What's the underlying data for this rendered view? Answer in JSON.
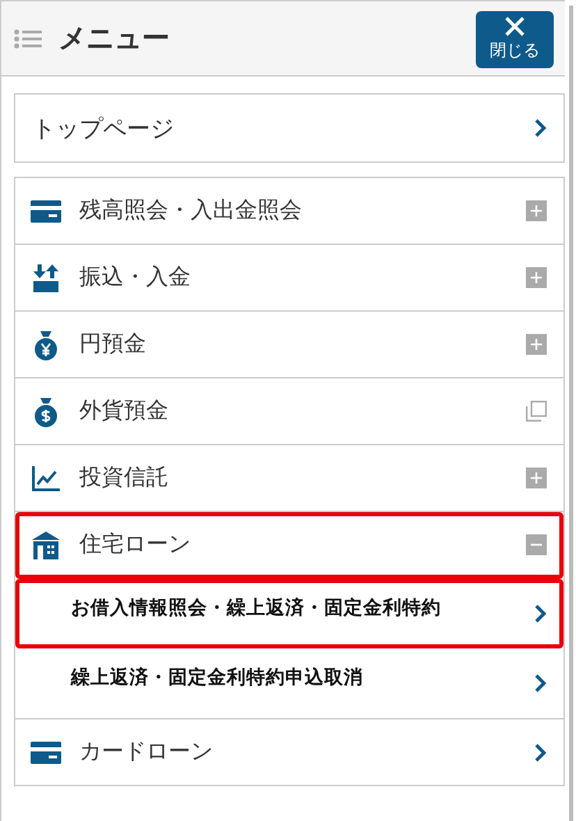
{
  "header": {
    "title": "メニュー",
    "close_button": {
      "label": "閉じる"
    }
  },
  "top_link": {
    "label": "トップページ"
  },
  "menu": [
    {
      "label": "残高照会・入出金照会",
      "kind": "expandable",
      "expanded": false,
      "highlighted": false
    },
    {
      "label": "振込・入金",
      "kind": "expandable",
      "expanded": false,
      "highlighted": false
    },
    {
      "label": "円預金",
      "kind": "expandable",
      "expanded": false,
      "highlighted": false
    },
    {
      "label": "外貨預金",
      "kind": "external",
      "highlighted": false
    },
    {
      "label": "投資信託",
      "kind": "expandable",
      "expanded": false,
      "highlighted": false
    },
    {
      "label": "住宅ローン",
      "kind": "expandable",
      "expanded": true,
      "highlighted": true,
      "children": [
        {
          "label": "お借入情報照会・繰上返済・固定金利特約",
          "highlighted": true
        },
        {
          "label": "繰上返済・固定金利特約申込取消",
          "highlighted": false
        }
      ]
    },
    {
      "label": "カードローン",
      "kind": "link",
      "highlighted": false
    }
  ]
}
